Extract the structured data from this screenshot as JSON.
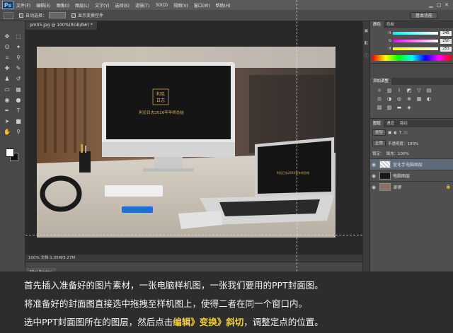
{
  "menubar": {
    "items": [
      "文件(F)",
      "编辑(E)",
      "图像(I)",
      "图层(L)",
      "文字(Y)",
      "选择(S)",
      "滤镜(T)",
      "3D(D)",
      "视图(V)",
      "窗口(W)",
      "帮助(H)"
    ]
  },
  "options": {
    "auto_select": "自动选择：",
    "show_transform": "显示变换控件",
    "workspace": "基本功能"
  },
  "document": {
    "tab_title": "pm05.jpg @ 100%(RGB/8#) *",
    "status": "100%    文档:1.35M/3.27M",
    "minibridge": "Mini Bridge",
    "screen_logo_top": "利见",
    "screen_logo_bottom": "日志",
    "screen_title": "利见日志2016年年终总结"
  },
  "panels": {
    "color_tabs": [
      "颜色",
      "色板"
    ],
    "color_values": {
      "r": "245",
      "g": "250",
      "b": "253"
    },
    "adjust_title": "添加调整",
    "layers_tabs": [
      "图层",
      "通道",
      "路径"
    ],
    "kind_filter": "类型",
    "blend_mode": "正常",
    "opacity": "不透明度：100%",
    "lock_label": "锁定：",
    "fill": "填充：100%",
    "layers": [
      {
        "name": "宣化手电脑图层",
        "selected": true
      },
      {
        "name": "电脑图层",
        "selected": false
      },
      {
        "name": "背景",
        "selected": false
      }
    ]
  },
  "caption": {
    "line1": "首先插入准备好的图片素材，一张电脑样机图，一张我们要用的PPT封面图。",
    "line2": "将准备好的封面图直接选中拖拽至样机图上，使得二者在同一个窗口内。",
    "line3_prefix": "选中PPT封面图所在的图层，然后点击",
    "line3_highlight": "编辑》变换》斜切",
    "line3_suffix": "，调整定点的位置。"
  },
  "colors": {
    "accent_highlight": "#f4d030",
    "menubar": "#5a5a5a",
    "panel": "#4a4a4a"
  }
}
